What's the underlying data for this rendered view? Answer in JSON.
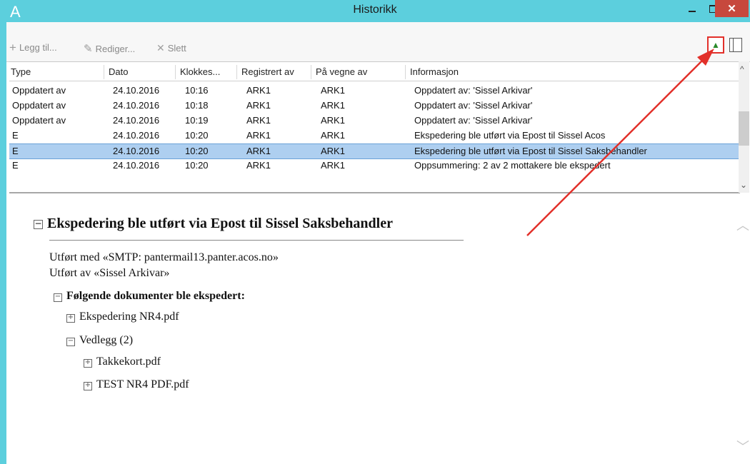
{
  "window": {
    "title": "Historikk",
    "logo": "A",
    "close_label": "✕"
  },
  "toolbar": {
    "add_label": "Legg til...",
    "edit_label": "Rediger...",
    "delete_label": "Slett"
  },
  "table": {
    "columns": [
      "Type",
      "Dato",
      "Klokkes...",
      "Registrert av",
      "På vegne av",
      "Informasjon"
    ],
    "rows": [
      [
        "Oppdatert av",
        "24.10.2016",
        "10:16",
        "ARK1",
        "ARK1",
        "Oppdatert av: 'Sissel Arkivar'"
      ],
      [
        "Oppdatert av",
        "24.10.2016",
        "10:18",
        "ARK1",
        "ARK1",
        "Oppdatert av: 'Sissel Arkivar'"
      ],
      [
        "Oppdatert av",
        "24.10.2016",
        "10:19",
        "ARK1",
        "ARK1",
        "Oppdatert av: 'Sissel Arkivar'"
      ],
      [
        "E",
        "24.10.2016",
        "10:20",
        "ARK1",
        "ARK1",
        "Ekspedering ble utført via Epost til Sissel Acos"
      ],
      [
        "E",
        "24.10.2016",
        "10:20",
        "ARK1",
        "ARK1",
        "Ekspedering ble utført via Epost til Sissel Saksbehandler"
      ],
      [
        "E",
        "24.10.2016",
        "10:20",
        "ARK1",
        "ARK1",
        "Oppsummering: 2 av 2 mottakere ble ekspedert"
      ]
    ],
    "selected_row": 4
  },
  "details": {
    "heading": "Ekspedering ble utført via Epost til Sissel Saksbehandler",
    "line1": "Utført med «SMTP: pantermail13.panter.acos.no»",
    "line2": "Utført av «Sissel Arkivar»",
    "documents_heading": "Følgende dokumenter ble ekspedert:",
    "doc1": "Ekspedering NR4.pdf",
    "attachments": "Vedlegg (2)",
    "att1": "Takkekort.pdf",
    "att2": "TEST NR4 PDF.pdf"
  },
  "colors": {
    "titlebar": "#5ccfdd",
    "close": "#c7483d",
    "selection": "#aecff0",
    "annotation_arrow": "#e2302a"
  }
}
